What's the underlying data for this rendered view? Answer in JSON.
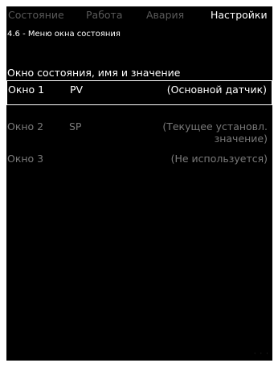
{
  "tabs": [
    {
      "label": "Состояние",
      "active": false
    },
    {
      "label": "Работа",
      "active": false
    },
    {
      "label": "Авария",
      "active": false
    },
    {
      "label": "Настройки",
      "active": true
    }
  ],
  "subtitle": "4.6 - Меню окна состояния",
  "section_heading": "Окно состояния, имя и значение",
  "rows": [
    {
      "name": "Окно 1",
      "code": "PV",
      "description_lines": [
        "(Основной датчик)"
      ],
      "selected": true
    },
    {
      "name": "Окно 2",
      "code": "SP",
      "description_lines": [
        "(Текущее установл.",
        "значение)"
      ],
      "selected": false
    },
    {
      "name": "Окно 3",
      "code": "",
      "description_lines": [
        "(Не используется)"
      ],
      "selected": false
    }
  ],
  "colors": {
    "background": "#000000",
    "text": "#ffffff",
    "inactive_text": "#5a5a5a",
    "dim_row_text": "#7a7a7a"
  }
}
